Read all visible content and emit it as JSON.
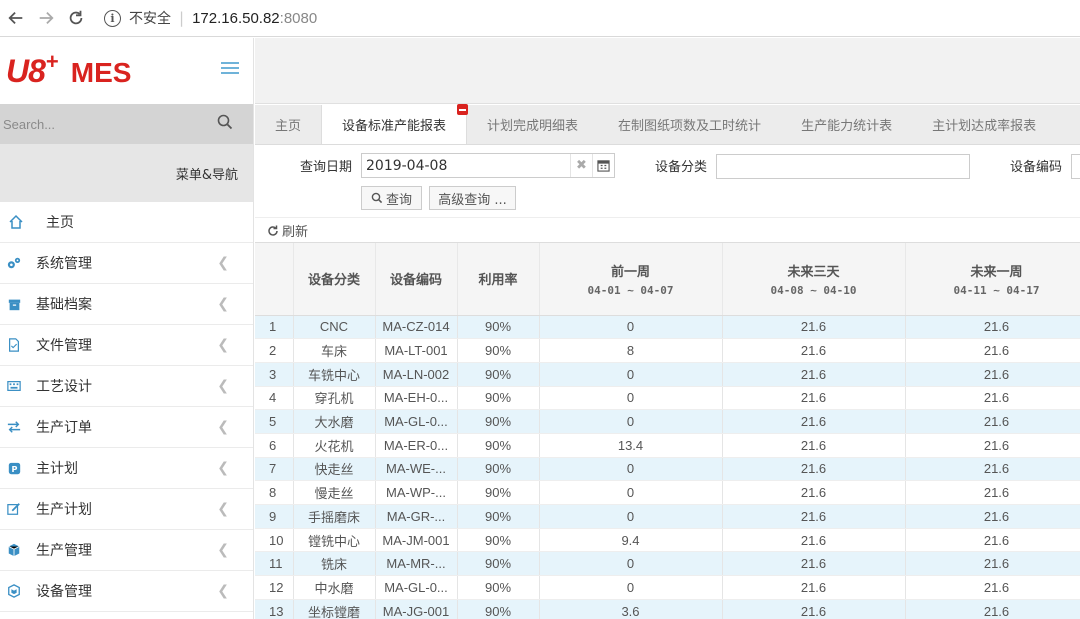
{
  "browser": {
    "security_label": "不安全",
    "host": "172.16.50.82",
    "port": ":8080"
  },
  "sidebar": {
    "logo_text": "U8",
    "logo_plus": "+",
    "logo_mes": "MES",
    "search_placeholder": "Search...",
    "menu_header": "菜单&导航",
    "items": [
      {
        "label": "主页",
        "icon": "home-icon"
      },
      {
        "label": "系统管理",
        "icon": "gears-icon"
      },
      {
        "label": "基础档案",
        "icon": "archive-icon"
      },
      {
        "label": "文件管理",
        "icon": "file-icon"
      },
      {
        "label": "工艺设计",
        "icon": "keyboard-icon"
      },
      {
        "label": "生产订单",
        "icon": "exchange-icon"
      },
      {
        "label": "主计划",
        "icon": "pinterest-icon"
      },
      {
        "label": "生产计划",
        "icon": "edit-icon"
      },
      {
        "label": "生产管理",
        "icon": "cube-icon"
      },
      {
        "label": "设备管理",
        "icon": "cubes-icon"
      }
    ]
  },
  "tabs": [
    {
      "label": "主页"
    },
    {
      "label": "设备标准产能报表",
      "active": true
    },
    {
      "label": "计划完成明细表"
    },
    {
      "label": "在制图纸项数及工时统计"
    },
    {
      "label": "生产能力统计表"
    },
    {
      "label": "主计划达成率报表"
    }
  ],
  "query": {
    "date_label": "查询日期",
    "date_value": "2019-04-08",
    "category_label": "设备分类",
    "code_label": "设备编码",
    "query_btn": "查询",
    "advanced_btn": "高级查询 ...",
    "refresh": "刷新"
  },
  "table": {
    "headers": {
      "category": "设备分类",
      "code": "设备编码",
      "util": "利用率",
      "prev_week": "前一周",
      "prev_week_range": "04-01 ~ 04-07",
      "next3": "未来三天",
      "next3_range": "04-08 ~ 04-10",
      "next_week": "未来一周",
      "next_week_range": "04-11 ~ 04-17"
    },
    "rows": [
      {
        "n": "1",
        "cat": "CNC",
        "code": "MA-CZ-014",
        "util": "90%",
        "prev": "0",
        "n3": "21.6",
        "nw": "21.6"
      },
      {
        "n": "2",
        "cat": "车床",
        "code": "MA-LT-001",
        "util": "90%",
        "prev": "8",
        "n3": "21.6",
        "nw": "21.6"
      },
      {
        "n": "3",
        "cat": "车铣中心",
        "code": "MA-LN-002",
        "util": "90%",
        "prev": "0",
        "n3": "21.6",
        "nw": "21.6"
      },
      {
        "n": "4",
        "cat": "穿孔机",
        "code": "MA-EH-0...",
        "util": "90%",
        "prev": "0",
        "n3": "21.6",
        "nw": "21.6"
      },
      {
        "n": "5",
        "cat": "大水磨",
        "code": "MA-GL-0...",
        "util": "90%",
        "prev": "0",
        "n3": "21.6",
        "nw": "21.6"
      },
      {
        "n": "6",
        "cat": "火花机",
        "code": "MA-ER-0...",
        "util": "90%",
        "prev": "13.4",
        "n3": "21.6",
        "nw": "21.6"
      },
      {
        "n": "7",
        "cat": "快走丝",
        "code": "MA-WE-...",
        "util": "90%",
        "prev": "0",
        "n3": "21.6",
        "nw": "21.6"
      },
      {
        "n": "8",
        "cat": "慢走丝",
        "code": "MA-WP-...",
        "util": "90%",
        "prev": "0",
        "n3": "21.6",
        "nw": "21.6"
      },
      {
        "n": "9",
        "cat": "手摇磨床",
        "code": "MA-GR-...",
        "util": "90%",
        "prev": "0",
        "n3": "21.6",
        "nw": "21.6"
      },
      {
        "n": "10",
        "cat": "镗铣中心",
        "code": "MA-JM-001",
        "util": "90%",
        "prev": "9.4",
        "n3": "21.6",
        "nw": "21.6"
      },
      {
        "n": "11",
        "cat": "铣床",
        "code": "MA-MR-...",
        "util": "90%",
        "prev": "0",
        "n3": "21.6",
        "nw": "21.6"
      },
      {
        "n": "12",
        "cat": "中水磨",
        "code": "MA-GL-0...",
        "util": "90%",
        "prev": "0",
        "n3": "21.6",
        "nw": "21.6"
      },
      {
        "n": "13",
        "cat": "坐标镗磨",
        "code": "MA-JG-001",
        "util": "90%",
        "prev": "3.6",
        "n3": "21.6",
        "nw": "21.6"
      }
    ]
  }
}
